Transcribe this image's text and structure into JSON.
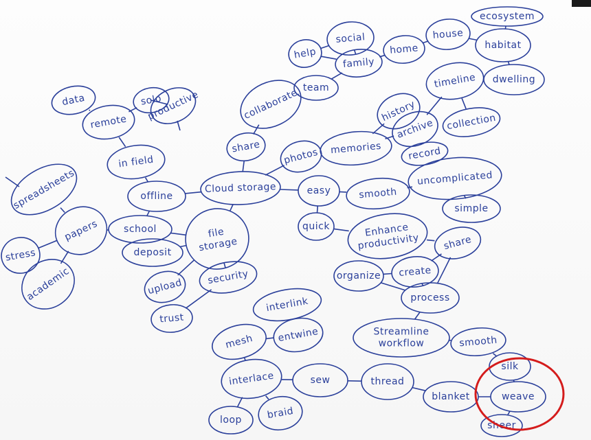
{
  "diagram": {
    "type": "mind-map",
    "colors": {
      "ink": "#2a3f9a",
      "highlight": "#d41c1c",
      "paper": "#fbfbfb"
    },
    "nodes": [
      {
        "id": "cloud",
        "label": "Cloud storage"
      },
      {
        "id": "offline",
        "label": "offline"
      },
      {
        "id": "infield",
        "label": "in field"
      },
      {
        "id": "remote",
        "label": "remote"
      },
      {
        "id": "data",
        "label": "data"
      },
      {
        "id": "solo",
        "label": "solo"
      },
      {
        "id": "productive",
        "label": "productive"
      },
      {
        "id": "school",
        "label": "school"
      },
      {
        "id": "papers",
        "label": "papers"
      },
      {
        "id": "spreadsheets",
        "label": "spreadsheets"
      },
      {
        "id": "stress",
        "label": "stress"
      },
      {
        "id": "academic",
        "label": "academic"
      },
      {
        "id": "filestorage",
        "label": "file storage"
      },
      {
        "id": "deposit",
        "label": "deposit"
      },
      {
        "id": "upload",
        "label": "upload"
      },
      {
        "id": "security",
        "label": "security"
      },
      {
        "id": "trust",
        "label": "trust"
      },
      {
        "id": "share",
        "label": "share"
      },
      {
        "id": "collaborate",
        "label": "collaborate"
      },
      {
        "id": "team",
        "label": "team"
      },
      {
        "id": "help",
        "label": "help"
      },
      {
        "id": "social",
        "label": "social"
      },
      {
        "id": "family",
        "label": "family"
      },
      {
        "id": "home",
        "label": "home"
      },
      {
        "id": "house",
        "label": "house"
      },
      {
        "id": "habitat",
        "label": "habitat"
      },
      {
        "id": "ecosystem",
        "label": "ecosystem"
      },
      {
        "id": "dwelling",
        "label": "dwelling"
      },
      {
        "id": "photos",
        "label": "photos"
      },
      {
        "id": "memories",
        "label": "memories"
      },
      {
        "id": "history",
        "label": "history"
      },
      {
        "id": "archive",
        "label": "archive"
      },
      {
        "id": "timeline",
        "label": "timeline"
      },
      {
        "id": "collection",
        "label": "collection"
      },
      {
        "id": "record",
        "label": "record"
      },
      {
        "id": "easy",
        "label": "easy"
      },
      {
        "id": "smooth1",
        "label": "smooth"
      },
      {
        "id": "uncomplicated",
        "label": "uncomplicated"
      },
      {
        "id": "simple",
        "label": "simple"
      },
      {
        "id": "quick",
        "label": "quick"
      },
      {
        "id": "enhance",
        "label": "Enhance productivity"
      },
      {
        "id": "organize",
        "label": "organize"
      },
      {
        "id": "create",
        "label": "create"
      },
      {
        "id": "share2",
        "label": "share"
      },
      {
        "id": "process",
        "label": "process"
      },
      {
        "id": "streamline",
        "label": "Streamline workflow"
      },
      {
        "id": "smooth2",
        "label": "smooth"
      },
      {
        "id": "silk",
        "label": "silk"
      },
      {
        "id": "weave",
        "label": "weave"
      },
      {
        "id": "sheer",
        "label": "sheer"
      },
      {
        "id": "blanket",
        "label": "blanket"
      },
      {
        "id": "thread",
        "label": "thread"
      },
      {
        "id": "sew",
        "label": "sew"
      },
      {
        "id": "interlace",
        "label": "interlace"
      },
      {
        "id": "mesh",
        "label": "mesh"
      },
      {
        "id": "entwine",
        "label": "entwine"
      },
      {
        "id": "interlink",
        "label": "interlink"
      },
      {
        "id": "loop",
        "label": "loop"
      },
      {
        "id": "braid",
        "label": "braid"
      }
    ],
    "edges": [
      [
        "cloud",
        "offline"
      ],
      [
        "cloud",
        "photos"
      ],
      [
        "cloud",
        "easy"
      ],
      [
        "cloud",
        "share"
      ],
      [
        "cloud",
        "filestorage"
      ],
      [
        "offline",
        "infield"
      ],
      [
        "infield",
        "remote"
      ],
      [
        "remote",
        "data"
      ],
      [
        "remote",
        "solo"
      ],
      [
        "solo",
        "productive"
      ],
      [
        "offline",
        "school"
      ],
      [
        "school",
        "papers"
      ],
      [
        "papers",
        "spreadsheets"
      ],
      [
        "papers",
        "stress"
      ],
      [
        "papers",
        "academic"
      ],
      [
        "school",
        "filestorage"
      ],
      [
        "filestorage",
        "deposit"
      ],
      [
        "filestorage",
        "upload"
      ],
      [
        "filestorage",
        "security"
      ],
      [
        "security",
        "trust"
      ],
      [
        "share",
        "collaborate"
      ],
      [
        "collaborate",
        "team"
      ],
      [
        "team",
        "family"
      ],
      [
        "help",
        "social"
      ],
      [
        "help",
        "family"
      ],
      [
        "social",
        "family"
      ],
      [
        "family",
        "home"
      ],
      [
        "home",
        "house"
      ],
      [
        "house",
        "habitat"
      ],
      [
        "habitat",
        "ecosystem"
      ],
      [
        "habitat",
        "dwelling"
      ],
      [
        "photos",
        "memories"
      ],
      [
        "memories",
        "history"
      ],
      [
        "memories",
        "archive"
      ],
      [
        "archive",
        "timeline"
      ],
      [
        "archive",
        "record"
      ],
      [
        "timeline",
        "collection"
      ],
      [
        "easy",
        "smooth1"
      ],
      [
        "smooth1",
        "uncomplicated"
      ],
      [
        "uncomplicated",
        "simple"
      ],
      [
        "easy",
        "quick"
      ],
      [
        "quick",
        "enhance"
      ],
      [
        "enhance",
        "share2"
      ],
      [
        "organize",
        "create"
      ],
      [
        "create",
        "share2"
      ],
      [
        "organize",
        "process"
      ],
      [
        "create",
        "process"
      ],
      [
        "share2",
        "process"
      ],
      [
        "process",
        "streamline"
      ],
      [
        "streamline",
        "smooth2"
      ],
      [
        "smooth2",
        "silk"
      ],
      [
        "silk",
        "weave"
      ],
      [
        "weave",
        "sheer"
      ],
      [
        "weave",
        "blanket"
      ],
      [
        "blanket",
        "thread"
      ],
      [
        "thread",
        "sew"
      ],
      [
        "sew",
        "interlace"
      ],
      [
        "interlace",
        "mesh"
      ],
      [
        "mesh",
        "entwine"
      ],
      [
        "entwine",
        "interlink"
      ],
      [
        "interlace",
        "loop"
      ],
      [
        "interlace",
        "braid"
      ]
    ]
  }
}
